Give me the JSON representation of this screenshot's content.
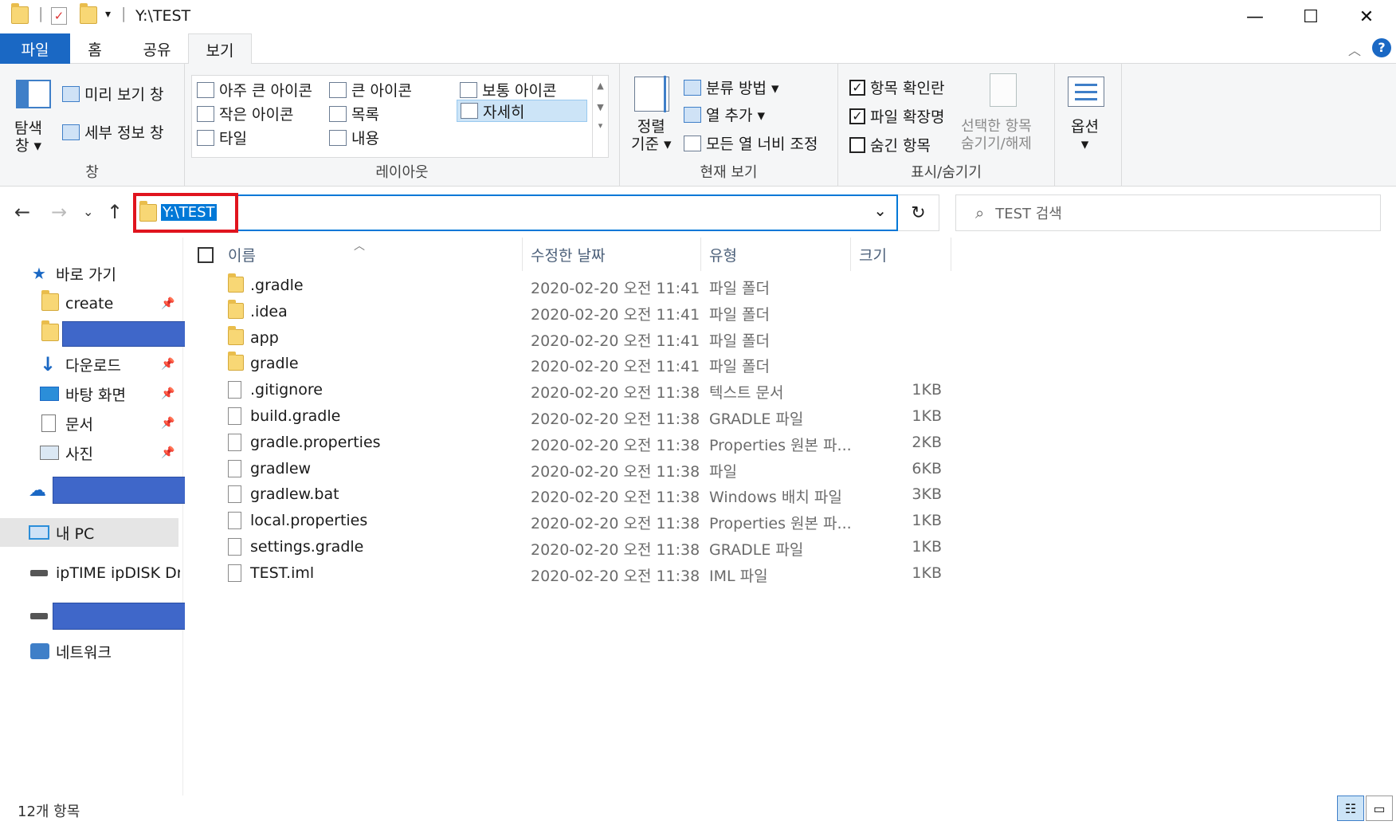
{
  "window": {
    "title": "Y:\\TEST",
    "minimize": "—",
    "maximize": "☐",
    "close": "✕"
  },
  "ribbon_tabs": [
    "파일",
    "홈",
    "공유",
    "보기"
  ],
  "ribbon": {
    "pane": {
      "nav_pane_label": "탐색\n창 ▾",
      "preview_pane": "미리 보기 창",
      "details_pane": "세부 정보 창",
      "group_label": "창"
    },
    "layout": {
      "items": [
        "아주 큰 아이콘",
        "큰 아이콘",
        "보통 아이콘",
        "작은 아이콘",
        "목록",
        "자세히",
        "타일",
        "내용"
      ],
      "selected": "자세히",
      "group_label": "레이아웃"
    },
    "current_view": {
      "sort_label": "정렬\n기준 ▾",
      "group_by": "분류 방법 ▾",
      "add_columns": "열 추가 ▾",
      "size_all_columns": "모든 열 너비 조정",
      "group_label": "현재 보기"
    },
    "show_hide": {
      "item_checkboxes": "항목 확인란",
      "item_checkboxes_checked": true,
      "file_extensions": "파일 확장명",
      "file_extensions_checked": true,
      "hidden_items": "숨긴 항목",
      "hidden_items_checked": false,
      "hide_selected": "선택한 항목\n숨기기/해제",
      "group_label": "표시/숨기기"
    },
    "options": {
      "label": "옵션\n▾"
    }
  },
  "address": {
    "path": "Y:\\TEST",
    "search_placeholder": "TEST 검색",
    "refresh": "↻",
    "dropdown": "⌄"
  },
  "nav_pane": {
    "quick_access": "바로 가기",
    "items": [
      {
        "label": "create",
        "pinned": true
      },
      {
        "label": "다운로드",
        "pinned": true
      },
      {
        "label": "바탕 화면",
        "pinned": true
      },
      {
        "label": "문서",
        "pinned": true
      },
      {
        "label": "사진",
        "pinned": true
      }
    ],
    "this_pc": "내 PC",
    "drive": "ipTIME ipDISK Driv",
    "network": "네트워크"
  },
  "columns": [
    "이름",
    "수정한 날짜",
    "유형",
    "크기"
  ],
  "files": [
    {
      "name": ".gradle",
      "date": "2020-02-20 오전 11:41",
      "type": "파일 폴더",
      "size": "",
      "kind": "folder"
    },
    {
      "name": ".idea",
      "date": "2020-02-20 오전 11:41",
      "type": "파일 폴더",
      "size": "",
      "kind": "folder"
    },
    {
      "name": "app",
      "date": "2020-02-20 오전 11:41",
      "type": "파일 폴더",
      "size": "",
      "kind": "folder"
    },
    {
      "name": "gradle",
      "date": "2020-02-20 오전 11:41",
      "type": "파일 폴더",
      "size": "",
      "kind": "folder"
    },
    {
      "name": ".gitignore",
      "date": "2020-02-20 오전 11:38",
      "type": "텍스트 문서",
      "size": "1KB",
      "kind": "file"
    },
    {
      "name": "build.gradle",
      "date": "2020-02-20 오전 11:38",
      "type": "GRADLE 파일",
      "size": "1KB",
      "kind": "file"
    },
    {
      "name": "gradle.properties",
      "date": "2020-02-20 오전 11:38",
      "type": "Properties 원본 파...",
      "size": "2KB",
      "kind": "file"
    },
    {
      "name": "gradlew",
      "date": "2020-02-20 오전 11:38",
      "type": "파일",
      "size": "6KB",
      "kind": "file"
    },
    {
      "name": "gradlew.bat",
      "date": "2020-02-20 오전 11:38",
      "type": "Windows 배치 파일",
      "size": "3KB",
      "kind": "file"
    },
    {
      "name": "local.properties",
      "date": "2020-02-20 오전 11:38",
      "type": "Properties 원본 파...",
      "size": "1KB",
      "kind": "file"
    },
    {
      "name": "settings.gradle",
      "date": "2020-02-20 오전 11:38",
      "type": "GRADLE 파일",
      "size": "1KB",
      "kind": "file"
    },
    {
      "name": "TEST.iml",
      "date": "2020-02-20 오전 11:38",
      "type": "IML 파일",
      "size": "1KB",
      "kind": "file"
    }
  ],
  "status": {
    "item_count": "12개 항목"
  },
  "colors": {
    "accent": "#0078d7",
    "file_tab": "#1a68c4",
    "highlight_box": "#e0141e",
    "redaction": "#3f67c9"
  }
}
